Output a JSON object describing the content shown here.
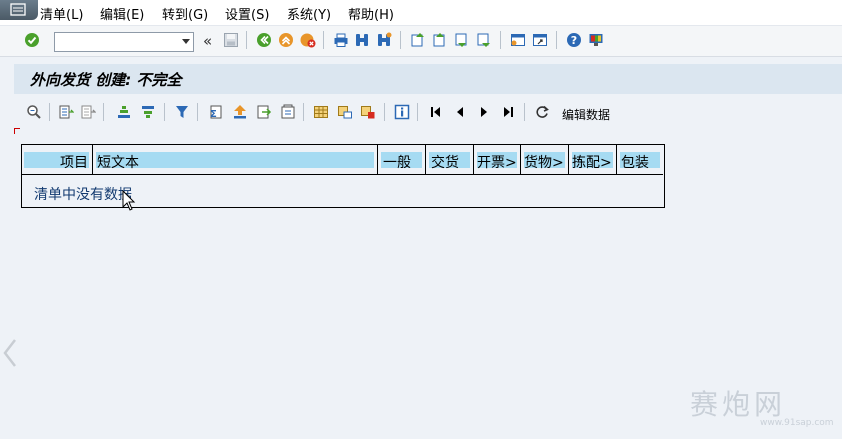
{
  "menu": {
    "items": [
      "清单(L)",
      "编辑(E)",
      "转到(G)",
      "设置(S)",
      "系统(Y)",
      "帮助(H)"
    ]
  },
  "toolbar": {
    "command_field_value": "",
    "back_glyph": "«"
  },
  "screen": {
    "title": "外向发货 创建: 不完全"
  },
  "app_toolbar": {
    "edit_data_label": "编辑数据"
  },
  "grid": {
    "columns": [
      "项目",
      "短文本",
      "一般",
      "交货",
      "开票>",
      "货物>",
      "拣配>",
      "包装"
    ],
    "empty_message": "清单中没有数据"
  },
  "colors": {
    "header_fill": "#a6dbf2",
    "title_bar": "#dbe6f0",
    "accent_green": "#4aa02c",
    "accent_orange": "#e8952a",
    "accent_blue": "#2c69b5"
  },
  "watermark": {
    "text": "赛炮网",
    "url": "www.91sap.com"
  }
}
